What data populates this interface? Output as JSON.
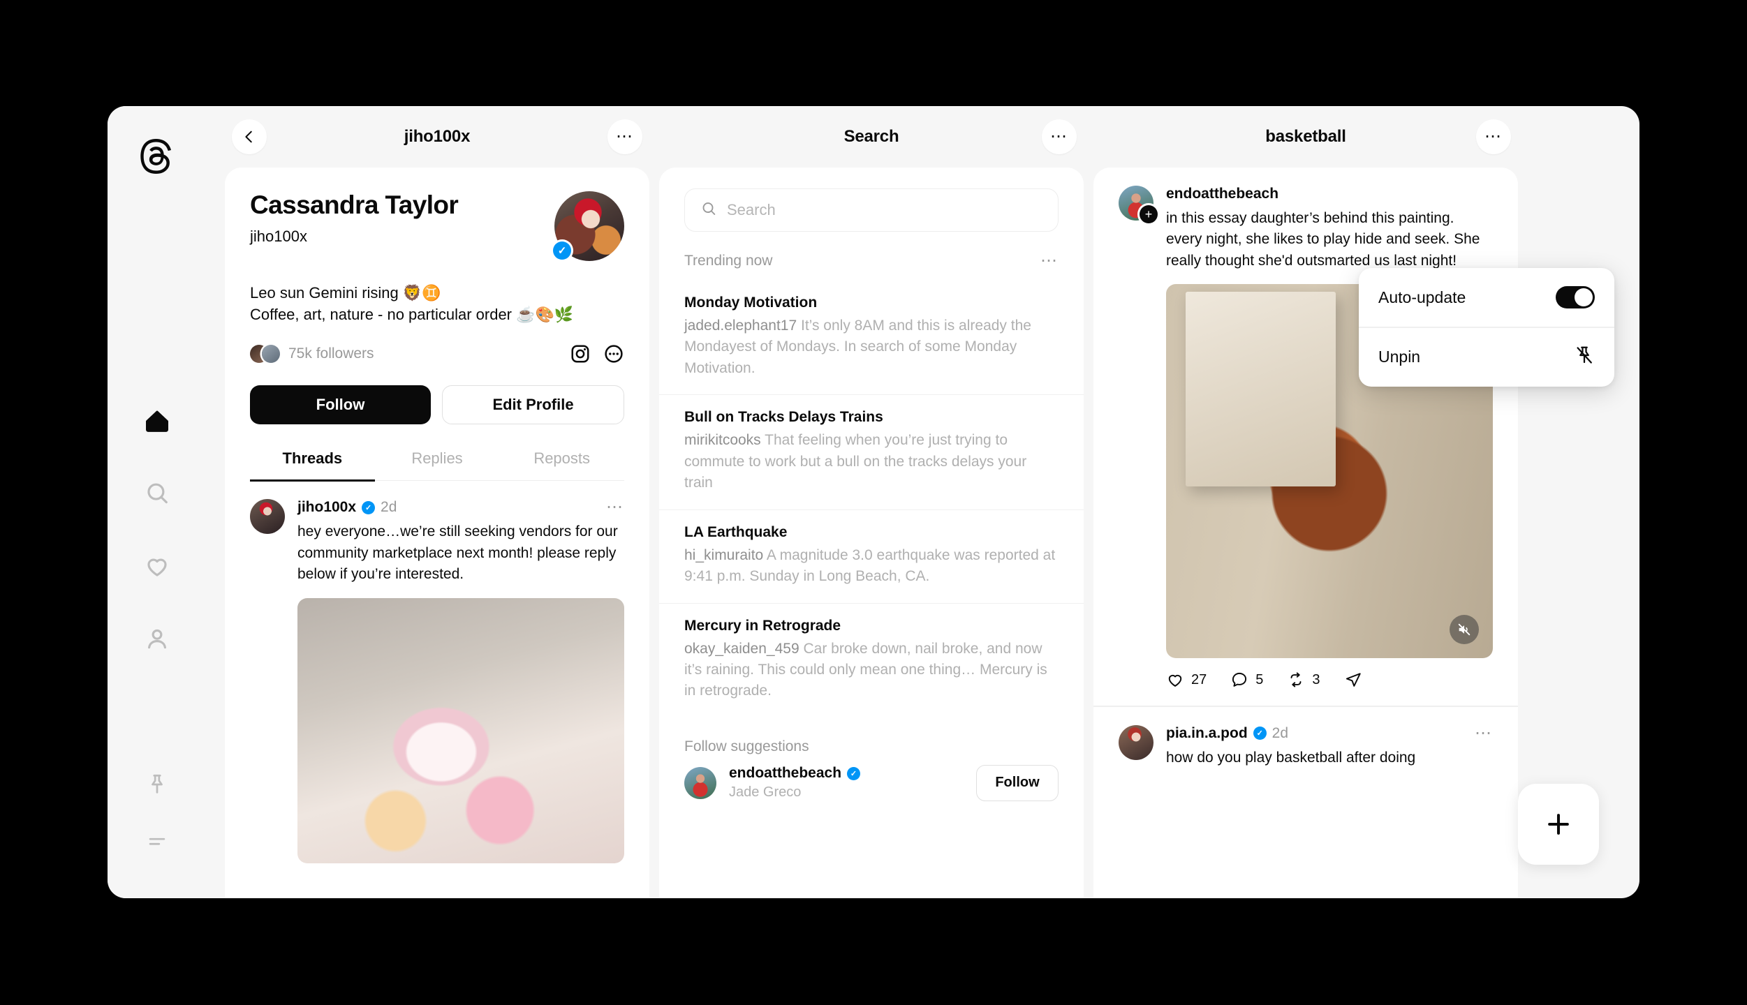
{
  "app": {
    "name": "Threads",
    "logo_icon": "threads-logo-icon"
  },
  "sidebar": {
    "items": [
      {
        "id": "home",
        "icon": "home-icon",
        "label": "Home",
        "active": true
      },
      {
        "id": "search",
        "icon": "search-icon",
        "label": "Search",
        "active": false
      },
      {
        "id": "activity",
        "icon": "heart-icon",
        "label": "Activity",
        "active": false
      },
      {
        "id": "profile",
        "icon": "person-icon",
        "label": "Profile",
        "active": false
      }
    ],
    "bottom_items": [
      {
        "id": "pinned",
        "icon": "pin-icon",
        "label": "Pinned columns"
      },
      {
        "id": "more",
        "icon": "menu-icon",
        "label": "More"
      }
    ]
  },
  "columns": {
    "profile": {
      "header": {
        "title": "jiho100x",
        "back_icon": "back-arrow-icon",
        "more_icon": "ellipsis-icon"
      },
      "display_name": "Cassandra Taylor",
      "handle": "jiho100x",
      "verified": true,
      "bio_line1": "Leo sun Gemini rising 🦁♊️",
      "bio_line2": "Coffee, art, nature - no particular order ☕🎨🌿",
      "followers": "75k followers",
      "instagram_icon": "instagram-icon",
      "more_icon": "ellipsis-circle-icon",
      "follow_label": "Follow",
      "edit_profile_label": "Edit Profile",
      "tabs": [
        {
          "label": "Threads",
          "active": true
        },
        {
          "label": "Replies",
          "active": false
        },
        {
          "label": "Reposts",
          "active": false
        }
      ],
      "post": {
        "username": "jiho100x",
        "verified": true,
        "time": "2d",
        "more_icon": "ellipsis-icon",
        "text": "hey everyone…we’re still seeking vendors for our community marketplace next month! please reply below if you’re interested.",
        "has_image": true
      }
    },
    "search": {
      "header": {
        "title": "Search",
        "more_icon": "ellipsis-icon"
      },
      "search_placeholder": "Search",
      "search_value": "",
      "search_icon": "search-icon",
      "trending_title": "Trending now",
      "trending_more_icon": "ellipsis-icon",
      "trending": [
        {
          "title": "Monday Motivation",
          "user": "jaded.elephant17",
          "desc": "It’s only 8AM and this is already the Mondayest of Mondays. In search of some Monday Motivation."
        },
        {
          "title": "Bull on Tracks Delays Trains",
          "user": "mirikitcooks",
          "desc": "That feeling when you’re just trying to commute to work but a bull on the tracks delays your train"
        },
        {
          "title": "LA Earthquake",
          "user": "hi_kimuraito",
          "desc": "A magnitude 3.0 earthquake was reported at 9:41 p.m. Sunday in Long Beach, CA."
        },
        {
          "title": "Mercury in Retrograde",
          "user": "okay_kaiden_459",
          "desc": "Car broke down, nail broke, and now it’s raining. This could only mean one thing… Mercury is in retrograde."
        }
      ],
      "suggestions_title": "Follow suggestions",
      "suggestions": [
        {
          "username": "endoatthebeach",
          "verified": true,
          "name": "Jade Greco",
          "follow_label": "Follow"
        }
      ]
    },
    "basketball": {
      "header": {
        "title": "basketball",
        "more_icon": "ellipsis-icon"
      },
      "posts": [
        {
          "username": "endoatthebeach",
          "verified": true,
          "add_icon": "plus-badge-icon",
          "text": "in this essay daughter’s behind this painting. every night, she likes to play hide and seek. She really thought she'd outsmarted us last night!",
          "has_image": true,
          "mute_icon": "mute-icon",
          "actions": {
            "like_icon": "heart-icon",
            "like_count": "27",
            "reply_icon": "comment-icon",
            "reply_count": "5",
            "repost_icon": "repost-icon",
            "repost_count": "3",
            "share_icon": "share-icon"
          }
        },
        {
          "username": "pia.in.a.pod",
          "verified": true,
          "time": "2d",
          "more_icon": "ellipsis-icon",
          "text": "how do you play basketball after doing"
        }
      ]
    }
  },
  "menu": {
    "items": [
      {
        "label": "Auto-update",
        "control": "toggle",
        "icon": "toggle-on-icon",
        "on": true
      },
      {
        "label": "Unpin",
        "control": "icon",
        "icon": "unpin-icon"
      }
    ]
  },
  "fab": {
    "icon": "plus-icon",
    "label": "New thread"
  },
  "colors": {
    "accent_verified": "#0095f6",
    "primary": "#0a0a0a",
    "app_bg": "#f6f6f6",
    "card_bg": "#ffffff",
    "muted_text": "#b0b0b0"
  }
}
